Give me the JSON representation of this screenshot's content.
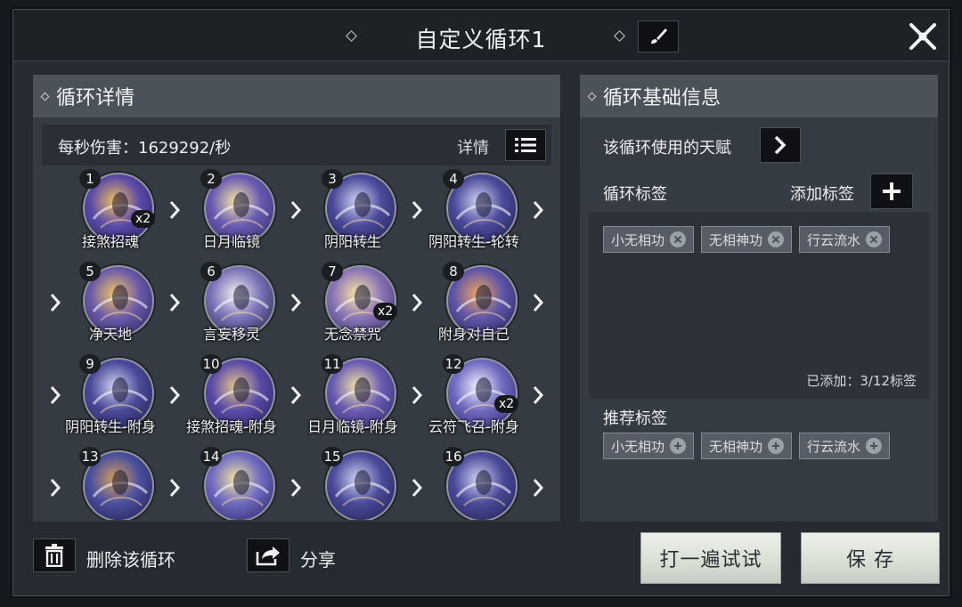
{
  "window": {
    "title": "自定义循环1",
    "close_icon": "close-icon",
    "brush_icon": "brush-icon"
  },
  "left_panel": {
    "title": "循环详情",
    "dps": "每秒伤害：1629292/秒",
    "detail_label": "详情",
    "skills": [
      {
        "num": "1",
        "name": "接煞招魂",
        "mult": "x2",
        "palette": [
          "#f1c15d",
          "#5b4aa8",
          "#221f55"
        ]
      },
      {
        "num": "2",
        "name": "日月临镜",
        "mult": "",
        "palette": [
          "#f7e6a6",
          "#6a5ab3",
          "#2a2761"
        ]
      },
      {
        "num": "3",
        "name": "阴阳转生",
        "mult": "",
        "palette": [
          "#cfd3f2",
          "#4a4a9a",
          "#1e1d4e"
        ]
      },
      {
        "num": "4",
        "name": "阴阳转生-轮转",
        "mult": "",
        "palette": [
          "#cfd3f2",
          "#4a4a9a",
          "#1e1d4e"
        ]
      },
      {
        "num": "5",
        "name": "净天地",
        "mult": "",
        "palette": [
          "#f3c667",
          "#6b5aa8",
          "#241f58"
        ]
      },
      {
        "num": "6",
        "name": "言妄移灵",
        "mult": "",
        "palette": [
          "#f0f0f0",
          "#7b73b8",
          "#1c1a3c"
        ]
      },
      {
        "num": "7",
        "name": "无念禁咒",
        "mult": "x2",
        "palette": [
          "#fbe6a3",
          "#8a74b6",
          "#2a2560"
        ]
      },
      {
        "num": "8",
        "name": "附身对自己",
        "mult": "",
        "palette": [
          "#f0a760",
          "#5f55a8",
          "#241f55"
        ]
      },
      {
        "num": "9",
        "name": "阴阳转生-附身",
        "mult": "",
        "palette": [
          "#cfd3f2",
          "#4a4a9a",
          "#1e1d4e"
        ]
      },
      {
        "num": "10",
        "name": "接煞招魂-附身",
        "mult": "",
        "palette": [
          "#e6c98a",
          "#5b4aa8",
          "#221f55"
        ]
      },
      {
        "num": "11",
        "name": "日月临镜-附身",
        "mult": "",
        "palette": [
          "#f7e6a6",
          "#6a5ab3",
          "#2a2761"
        ]
      },
      {
        "num": "12",
        "name": "云符飞召-附身",
        "mult": "x2",
        "palette": [
          "#f3f3ff",
          "#6f6ac0",
          "#232060"
        ]
      },
      {
        "num": "13",
        "name": "",
        "mult": "",
        "palette": [
          "#d6a05a",
          "#4b4f9e",
          "#1c1c4a"
        ]
      },
      {
        "num": "14",
        "name": "",
        "mult": "",
        "palette": [
          "#f2e6a0",
          "#6f6ac0",
          "#232060"
        ]
      },
      {
        "num": "15",
        "name": "",
        "mult": "",
        "palette": [
          "#cfd3f2",
          "#4a4a9a",
          "#1e1d4e"
        ]
      },
      {
        "num": "16",
        "name": "",
        "mult": "",
        "palette": [
          "#cfd3f2",
          "#4a4a9a",
          "#1e1d4e"
        ]
      }
    ]
  },
  "right_panel": {
    "title": "循环基础信息",
    "talent_label": "该循环使用的天赋",
    "tag_section_title": "循环标签",
    "add_tag_label": "添加标签",
    "tags": [
      "小无相功",
      "无相神功",
      "行云流水"
    ],
    "tag_count": "已添加：3/12标签",
    "recommended_label": "推荐标签",
    "recommended_tags": [
      "小无相功",
      "无相神功",
      "行云流水"
    ]
  },
  "bottom": {
    "delete_label": "删除该循环",
    "share_label": "分享",
    "try_label": "打一遍试试",
    "save_label": "保 存"
  }
}
